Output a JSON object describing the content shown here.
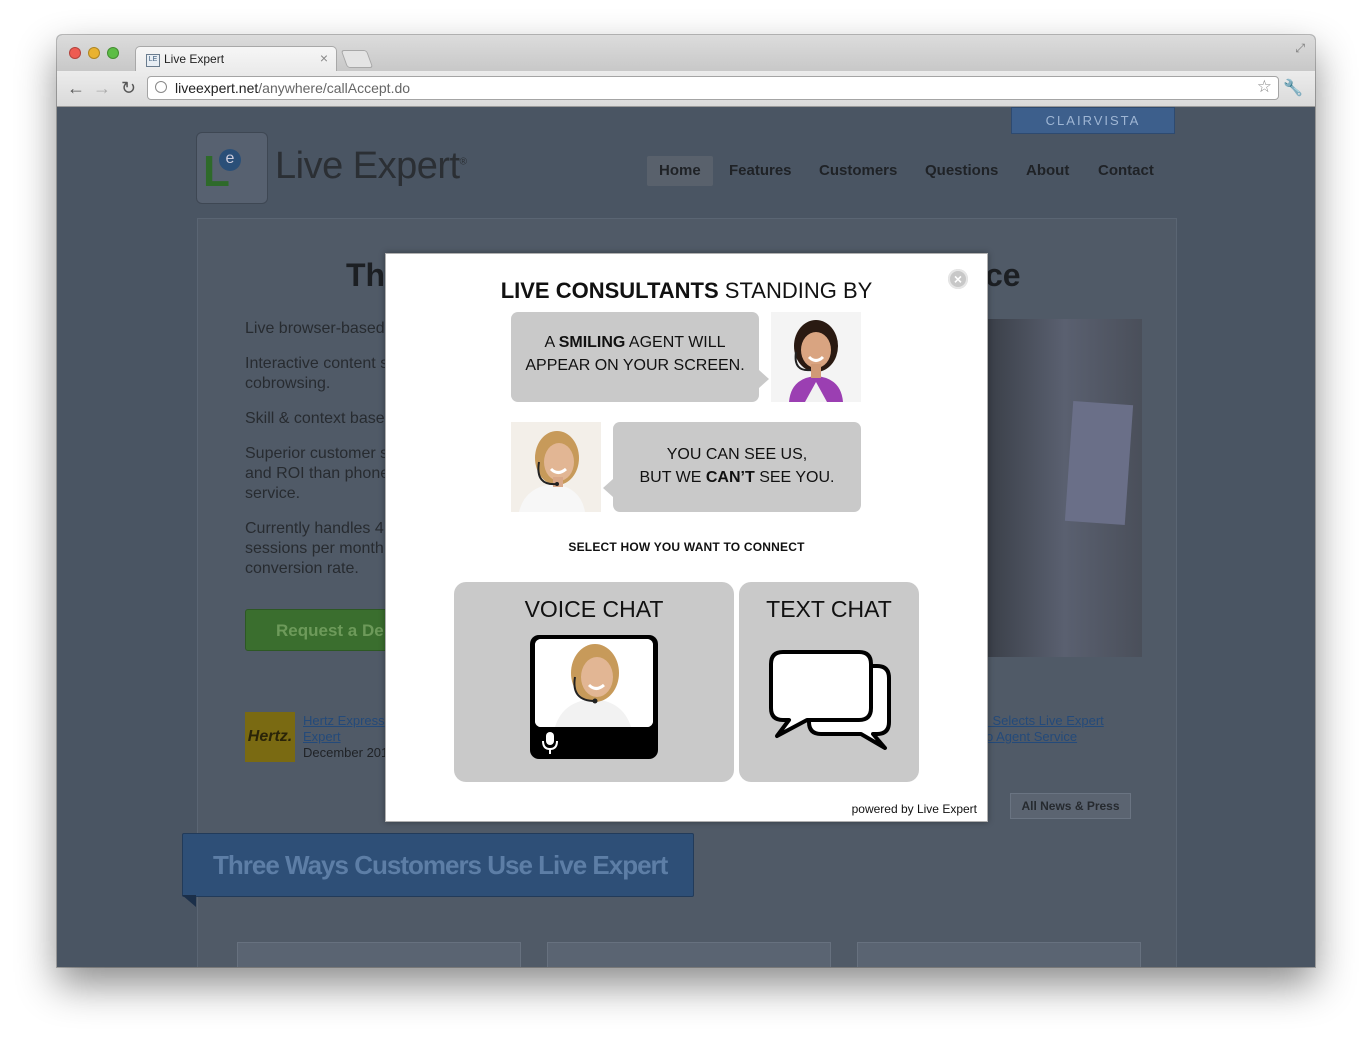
{
  "browser": {
    "tab_title": "Live Expert",
    "tab_close": "×",
    "url_host": "liveexpert.net",
    "url_path": "/anywhere/callAccept.do",
    "back_glyph": "←",
    "forward_glyph": "→",
    "reload_glyph": "↻",
    "star_glyph": "☆",
    "wrench_glyph": "🔧",
    "fullscreen_glyph": "⤢",
    "favicon_text": "LE"
  },
  "site": {
    "partner_badge": "CLAIRVISTA",
    "brand": "Live Expert",
    "brand_mark": "®",
    "nav": [
      "Home",
      "Features",
      "Customers",
      "Questions",
      "About",
      "Contact"
    ],
    "active_nav": "Home",
    "hero_heading_start": "Th",
    "hero_heading_end": "ce",
    "bullets": [
      [
        "Live browser-based"
      ],
      [
        "Interactive content s",
        "cobrowsing."
      ],
      [
        "Skill & context base"
      ],
      [
        "Superior customer s",
        "and ROI than phone",
        "service."
      ],
      [
        "Currently handles 4",
        "sessions per month",
        "conversion rate."
      ]
    ],
    "demo_button": "Request a De",
    "news_left": {
      "logo": "Hertz.",
      "link_line1": "Hertz Express",
      "link_line2": "Expert",
      "date": "December 201"
    },
    "news_right": {
      "link_line1": "i Selects Live Expert",
      "link_line2": "o Agent Service"
    },
    "all_news_button": "All News & Press",
    "three_ways_title": "Three Ways Customers Use Live Expert"
  },
  "modal": {
    "title_bold": "LIVE CONSULTANTS",
    "title_rest": " STANDING BY",
    "close_glyph": "×",
    "bubble1": {
      "line1_pre": "A ",
      "line1_bold": "SMILING",
      "line1_post": " AGENT WILL",
      "line2": "APPEAR ON YOUR SCREEN."
    },
    "bubble2": {
      "line1": "YOU CAN SEE US,",
      "line2_pre": "BUT WE ",
      "line2_bold": "CAN’T",
      "line2_post": " SEE YOU."
    },
    "select_label": "SELECT HOW YOU WANT TO CONNECT",
    "voice_chat_label": "VOICE CHAT",
    "text_chat_label": "TEXT CHAT",
    "powered_by": "powered by Live Expert"
  },
  "colors": {
    "page_dim": "#4a5563",
    "option_gray": "#c9c9c9",
    "demo_green": "#3a6e2e",
    "three_ways_blue": "#2e4f77"
  }
}
